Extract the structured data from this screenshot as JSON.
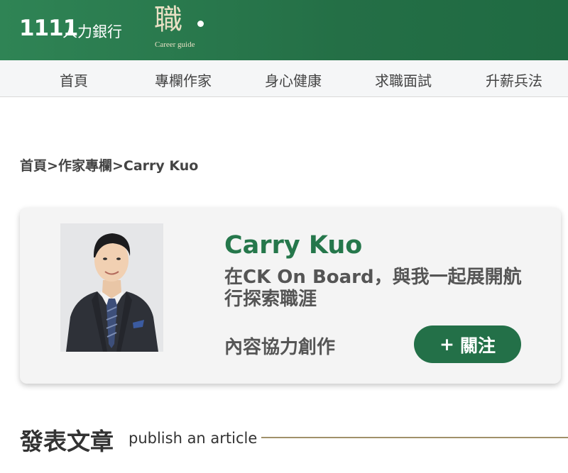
{
  "header": {
    "logo_number": "1111",
    "logo_bank": "人力銀行",
    "career_logo": "職",
    "career_sub": "Career guide",
    "brand_color": "#25774b"
  },
  "nav": {
    "items": [
      {
        "label": "首頁"
      },
      {
        "label": "專欄作家"
      },
      {
        "label": "身心健康"
      },
      {
        "label": "求職面試"
      },
      {
        "label": "升薪兵法"
      }
    ]
  },
  "breadcrumb": {
    "home": "首頁",
    "sep1": ">",
    "columnists": "作家專欄",
    "sep2": ">",
    "current": "Carry Kuo"
  },
  "author": {
    "name": "Carry Kuo",
    "tagline": "在CK On Board，與我一起展開航行探索職涯",
    "role": "內容協力創作",
    "follow_icon": "plus-icon",
    "follow_plus": "+",
    "follow_label": "關注"
  },
  "section": {
    "title": "發表文章",
    "subtitle": "publish an article"
  }
}
